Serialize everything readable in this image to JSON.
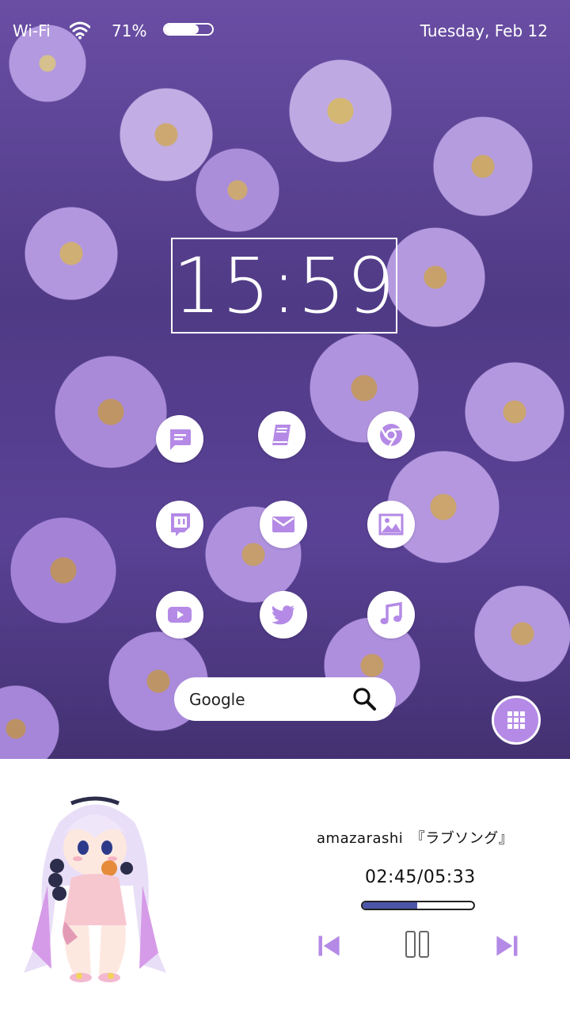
{
  "statusbar": {
    "wifi_label": "Wi-Fi",
    "battery_pct": "71%",
    "battery_level": 0.71,
    "date": "Tuesday, Feb 12"
  },
  "clock": {
    "time": "15:59"
  },
  "apps": [
    {
      "icon": "messages-icon"
    },
    {
      "icon": "book-icon"
    },
    {
      "icon": "chrome-icon"
    },
    {
      "icon": "twitch-icon"
    },
    {
      "icon": "mail-icon"
    },
    {
      "icon": "gallery-icon"
    },
    {
      "icon": "youtube-icon"
    },
    {
      "icon": "twitter-icon"
    },
    {
      "icon": "music-icon"
    }
  ],
  "search": {
    "label": "Google",
    "icon": "search-icon"
  },
  "drawer": {
    "icon": "app-grid-icon"
  },
  "player": {
    "track": "amazarashi　『ラブソング』",
    "time": "02:45/05:33",
    "progress": 0.495,
    "controls": [
      "previous-icon",
      "pause-icon",
      "next-icon"
    ]
  },
  "colors": {
    "accent": "#b48ae6",
    "progress": "#4b55a8"
  }
}
